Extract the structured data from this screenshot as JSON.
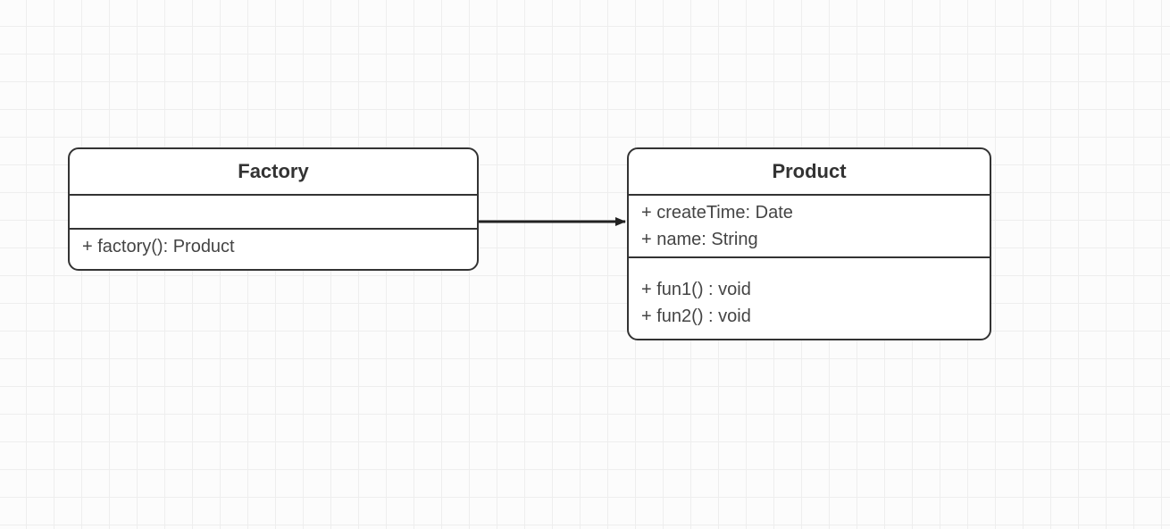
{
  "diagram": {
    "classes": {
      "factory": {
        "name": "Factory",
        "attributes": [],
        "methods": [
          "+ factory(): Product"
        ]
      },
      "product": {
        "name": "Product",
        "attributes": [
          "+ createTime: Date",
          "+ name: String"
        ],
        "methods": [
          "+ fun1() : void",
          "+ fun2() : void"
        ]
      }
    },
    "relationship": "association-arrow-factory-to-product"
  }
}
